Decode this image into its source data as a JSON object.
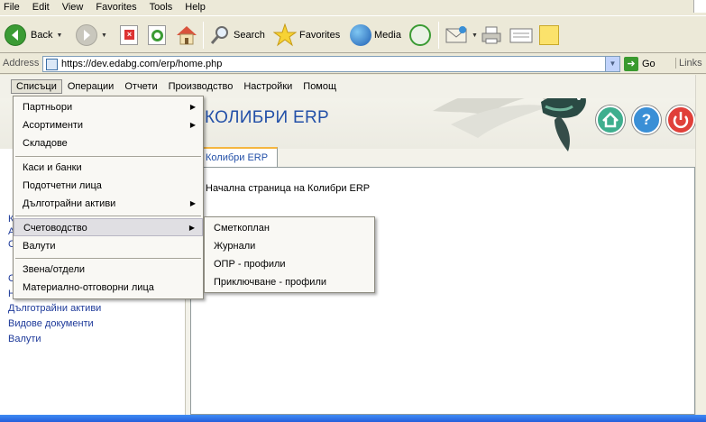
{
  "browser": {
    "menu": [
      "File",
      "Edit",
      "View",
      "Favorites",
      "Tools",
      "Help"
    ],
    "toolbar": {
      "back_label": "Back",
      "search_label": "Search",
      "favorites_label": "Favorites",
      "media_label": "Media"
    },
    "address": {
      "label": "Address",
      "url": "https://dev.edabg.com/erp/home.php",
      "go_label": "Go",
      "links_label": "Links"
    }
  },
  "app": {
    "menubar": [
      "Списъци",
      "Операции",
      "Отчети",
      "Производство",
      "Настройки",
      "Помощ"
    ],
    "title": "КОЛИБРИ ERP",
    "tab_label": "Колибри ERP",
    "welcome_text": "Начална страница на Колибри ERP",
    "left_links": [
      "К",
      "А",
      "С",
      "С",
      "Н",
      "Дълготрайни активи",
      "Видове документи",
      "Валути"
    ],
    "colors": {
      "title": "#2350a8",
      "home_btn": "#3fae8e",
      "help_btn": "#3a8fd6",
      "power_btn": "#e0403a"
    }
  },
  "lists_menu": {
    "items": [
      {
        "label": "Партньори",
        "submenu": true
      },
      {
        "label": "Асортименти",
        "submenu": true
      },
      {
        "label": "Складове",
        "submenu": false
      },
      {
        "label": "Каси и банки",
        "submenu": false
      },
      {
        "label": "Подотчетни лица",
        "submenu": false
      },
      {
        "label": "Дълготрайни активи",
        "submenu": true
      },
      {
        "label": "Счетоводство",
        "submenu": true,
        "highlighted": true
      },
      {
        "label": "Валути",
        "submenu": false
      },
      {
        "label": "Звена/отдели",
        "submenu": false
      },
      {
        "label": "Материално-отговорни лица",
        "submenu": false
      }
    ]
  },
  "accounting_submenu": {
    "items": [
      "Сметкоплан",
      "Журнали",
      "ОПР - профили",
      "Приключване - профили"
    ]
  }
}
